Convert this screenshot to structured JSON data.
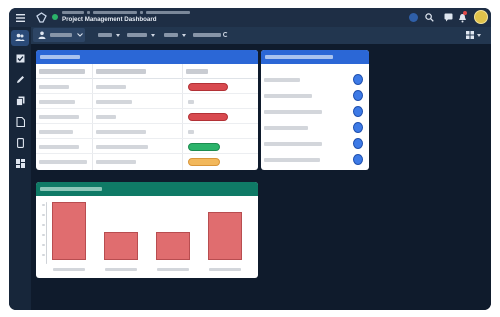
{
  "app": {
    "title": "Project Management Dashboard"
  },
  "colors": {
    "frame": "#0f1b2c",
    "topbar": "#1e2e45",
    "card_header_blue": "#2b67d6",
    "card_header_teal": "#0f7a66",
    "status_red": "#d84a4f",
    "status_green": "#2bb36a",
    "status_orange": "#f2b85c",
    "bar_fill": "#e06d6f",
    "avatar": "#e0c24a"
  },
  "icons": {
    "menu": "hamburger-icon",
    "logo": "app-logo-icon",
    "status": "online-status-icon",
    "help": "help-icon",
    "search": "search-icon",
    "chat": "chat-icon",
    "notifications": "bell-icon",
    "avatar": "user-avatar",
    "sidebar": [
      "users-icon",
      "checkbox-icon",
      "pencil-icon",
      "documents-icon",
      "file-icon",
      "mobile-icon",
      "dashboard-icon"
    ]
  },
  "notifications": {
    "has_unread": true
  },
  "status_pills": [
    "red",
    "red",
    "green",
    "orange"
  ],
  "chart_data": {
    "type": "bar",
    "title": "",
    "categories": [
      "",
      "",
      "",
      ""
    ],
    "values": [
      100,
      49,
      49,
      83
    ],
    "ylim": [
      0,
      100
    ],
    "grid": false
  }
}
